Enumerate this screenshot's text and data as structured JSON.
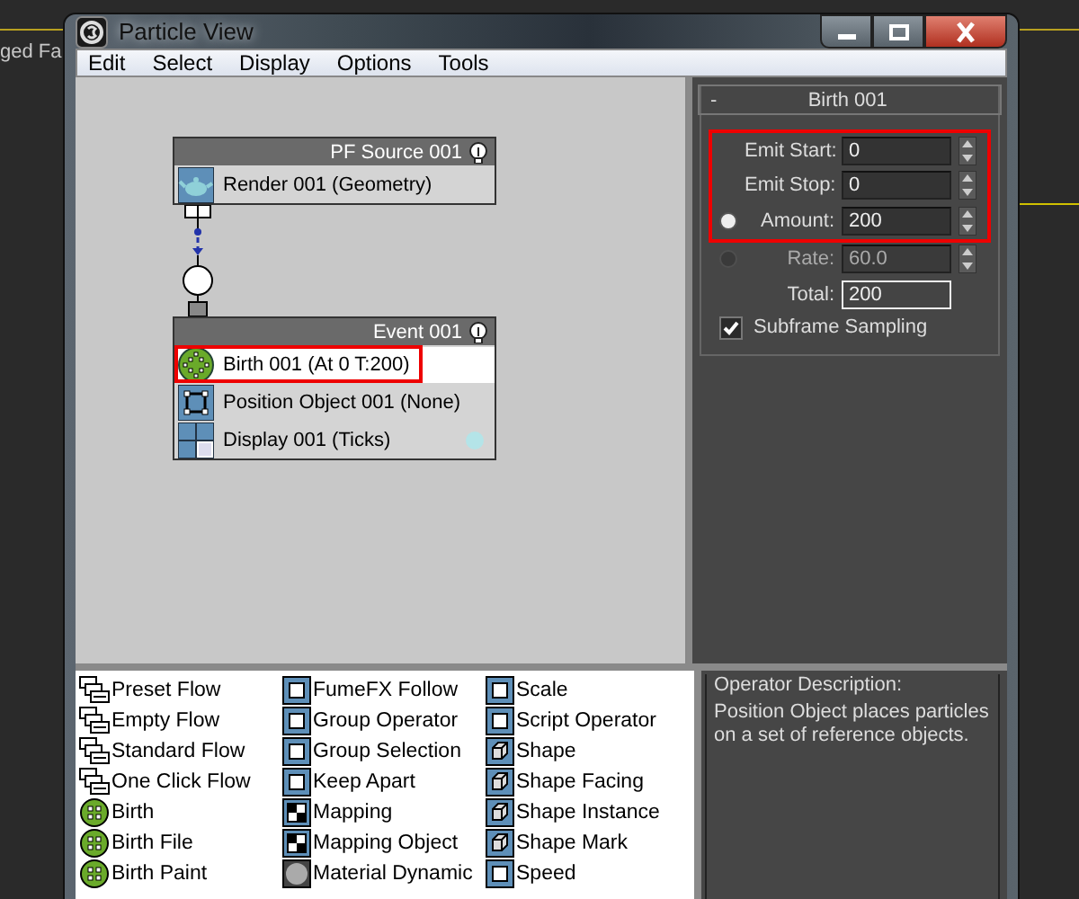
{
  "background_app": {
    "text": "ged Fa"
  },
  "window": {
    "title": "Particle View"
  },
  "menu": [
    {
      "label": "Edit"
    },
    {
      "label": "Select"
    },
    {
      "label": "Display"
    },
    {
      "label": "Options"
    },
    {
      "label": "Tools"
    }
  ],
  "flow": {
    "nodes": [
      {
        "title": "PF Source 001",
        "operators": [
          {
            "label": "Render 001 (Geometry)",
            "kind": "render",
            "selected": false
          }
        ]
      },
      {
        "title": "Event 001",
        "operators": [
          {
            "label": "Birth 001 (At 0 T:200)",
            "kind": "birth",
            "selected": true
          },
          {
            "label": "Position Object 001 (None)",
            "kind": "position",
            "selected": false
          },
          {
            "label": "Display 001 (Ticks)",
            "kind": "display",
            "selected": false,
            "color": "#b4e4e8"
          }
        ]
      }
    ]
  },
  "rollout": {
    "collapse": "-",
    "title": "Birth 001",
    "fields": [
      {
        "label": "Emit Start:",
        "value": "0",
        "kind": "spinner",
        "highlighted": true
      },
      {
        "label": "Emit Stop:",
        "value": "0",
        "kind": "spinner",
        "highlighted": true
      },
      {
        "label": "Amount:",
        "value": "200",
        "kind": "radio-spinner",
        "selected": true,
        "disabled": false,
        "highlighted": true
      },
      {
        "label": "Rate:",
        "value": "60.0",
        "kind": "radio-spinner",
        "selected": false,
        "disabled": true,
        "highlighted": false
      },
      {
        "label": "Total:",
        "value": "200",
        "kind": "readout",
        "highlighted": false
      }
    ],
    "checkbox": {
      "label": "Subframe Sampling",
      "checked": true
    }
  },
  "depot": {
    "columns": [
      [
        {
          "label": "Preset Flow",
          "kind": "flow"
        },
        {
          "label": "Empty Flow",
          "kind": "flow"
        },
        {
          "label": "Standard Flow",
          "kind": "flow"
        },
        {
          "label": "One Click Flow",
          "kind": "flow"
        },
        {
          "label": "Birth",
          "kind": "birth"
        },
        {
          "label": "Birth File",
          "kind": "birth"
        },
        {
          "label": "Birth Paint",
          "kind": "birth"
        }
      ],
      [
        {
          "label": "FumeFX Follow",
          "kind": "operator"
        },
        {
          "label": "Group Operator",
          "kind": "operator"
        },
        {
          "label": "Group Selection",
          "kind": "operator"
        },
        {
          "label": "Keep Apart",
          "kind": "operator"
        },
        {
          "label": "Mapping",
          "kind": "checker"
        },
        {
          "label": "Mapping Object",
          "kind": "checker"
        },
        {
          "label": "Material Dynamic",
          "kind": "sphere"
        }
      ],
      [
        {
          "label": "Scale",
          "kind": "operator"
        },
        {
          "label": "Script Operator",
          "kind": "operator"
        },
        {
          "label": "Shape",
          "kind": "shape"
        },
        {
          "label": "Shape Facing",
          "kind": "shape"
        },
        {
          "label": "Shape Instance",
          "kind": "shape"
        },
        {
          "label": "Shape Mark",
          "kind": "shape"
        },
        {
          "label": "Speed",
          "kind": "operator"
        }
      ]
    ]
  },
  "description": {
    "title": "Operator Description:",
    "text": "Position Object places particles on a set of reference objects."
  }
}
